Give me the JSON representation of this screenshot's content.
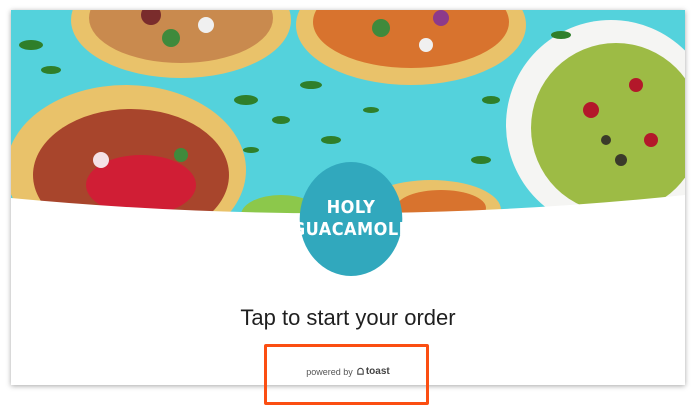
{
  "brand": {
    "line1": "HOLY",
    "line2": "GUACAMOLE",
    "color": "#31a8bd"
  },
  "cta_text": "Tap to start your order",
  "footer": {
    "powered_by": "powered by",
    "provider": "toast",
    "provider_icon": "toast-bell-icon"
  },
  "highlight_color": "#fb4e12",
  "hero_background": "#50d4de"
}
